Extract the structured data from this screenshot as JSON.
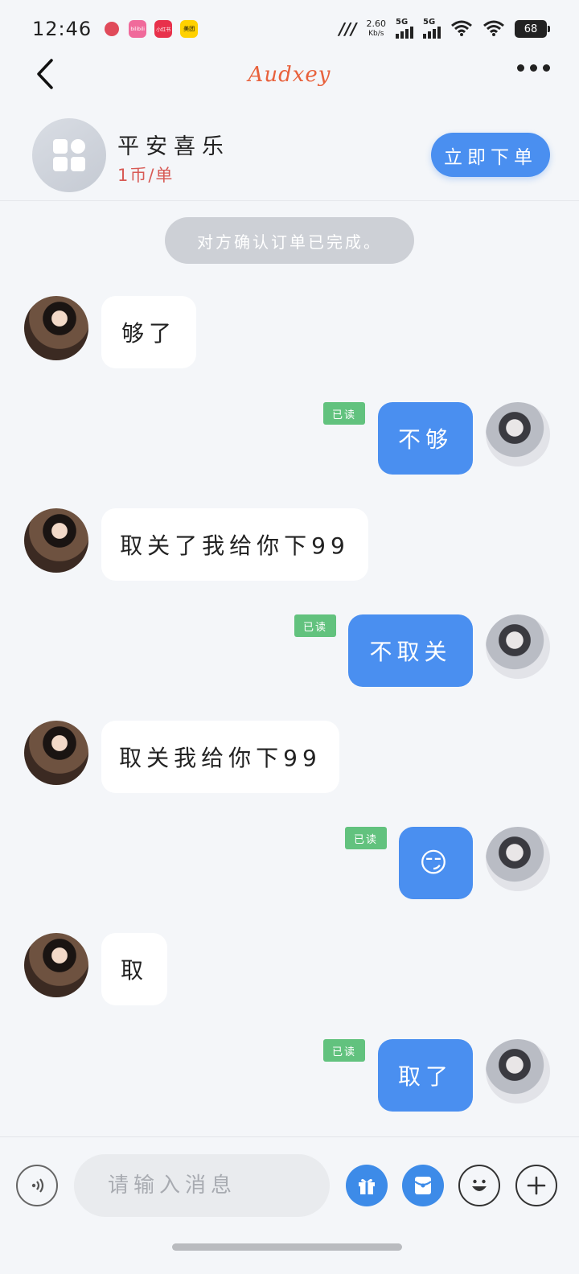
{
  "status": {
    "time": "12:46",
    "speed_value": "2.60",
    "speed_unit": "Kb/s",
    "sig1": "5G",
    "sig2": "5G",
    "battery": "68",
    "app_icons": [
      "bilibili",
      "小红书",
      "美团"
    ]
  },
  "nav": {
    "title": "Audxey"
  },
  "order": {
    "name": "平安喜乐",
    "price": "1币/单",
    "button": "立即下单"
  },
  "notice": "对方确认订单已完成。",
  "messages": [
    {
      "side": "in",
      "text": "够了"
    },
    {
      "side": "out",
      "text": "不够",
      "read": "已读"
    },
    {
      "side": "in",
      "text": "取关了我给你下99"
    },
    {
      "side": "out",
      "text": "不取关",
      "read": "已读"
    },
    {
      "side": "in",
      "text": "取关我给你下99"
    },
    {
      "side": "out",
      "text": "😏",
      "read": "已读"
    },
    {
      "side": "in",
      "text": "取"
    },
    {
      "side": "out",
      "text": "取了",
      "read": "已读"
    }
  ],
  "input": {
    "placeholder": "请输入消息"
  },
  "colors": {
    "accent": "#4a8ff0",
    "read_badge": "#62c27e",
    "title": "#e8613c",
    "price": "#d85a55"
  }
}
